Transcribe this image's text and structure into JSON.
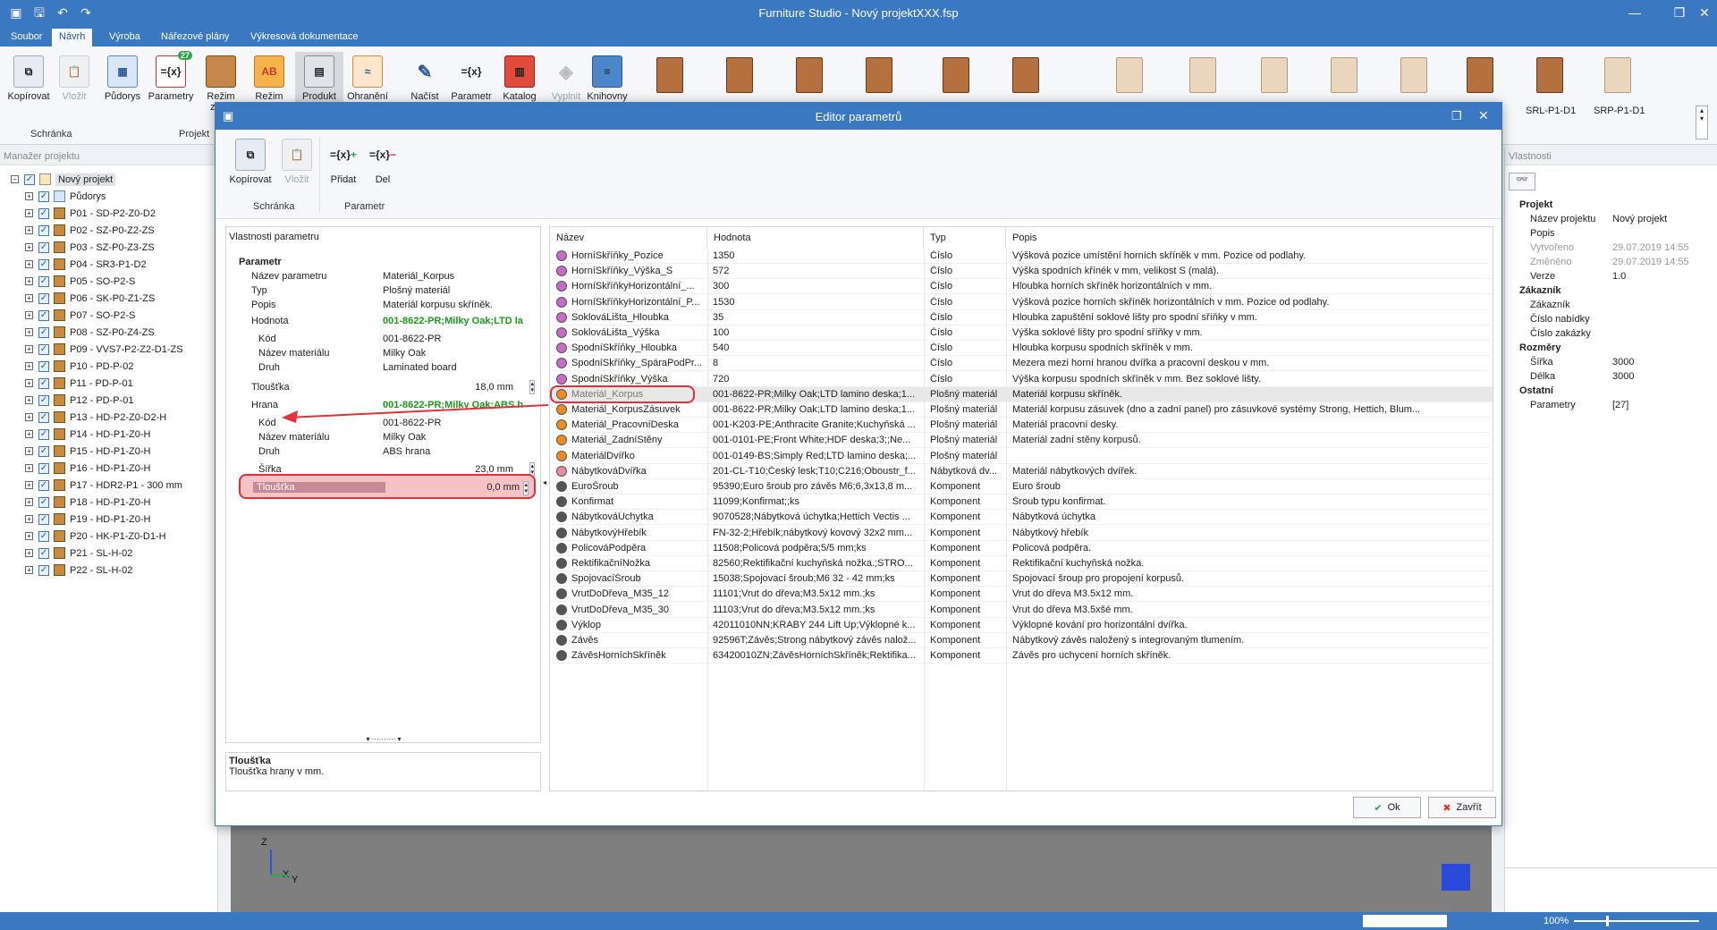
{
  "app": {
    "title": "Furniture Studio - Nový projektXXX.fsp"
  },
  "menu": [
    "Soubor",
    "Návrh",
    "Výroba",
    "Nářezové plány",
    "Výkresová dokumentace"
  ],
  "ribbon": {
    "buttons": [
      {
        "label": "Kopírovat",
        "icon": "copy-icon"
      },
      {
        "label": "Vložit",
        "icon": "paste-icon"
      },
      {
        "label": "Půdorys",
        "icon": "floorplan-icon"
      },
      {
        "label": "Parametry",
        "icon": "parameters-icon",
        "badge": "27"
      },
      {
        "label": "Režim zobr.",
        "icon": "display-mode-icon"
      },
      {
        "label": "Režim",
        "icon": "mode-icon"
      },
      {
        "label": "Produkt",
        "icon": "product-icon"
      },
      {
        "label": "Ohranění",
        "icon": "edging-icon"
      },
      {
        "label": "Načíst",
        "icon": "load-icon"
      },
      {
        "label": "Parametr",
        "icon": "parameter-icon"
      },
      {
        "label": "Katalog",
        "icon": "catalog-icon"
      },
      {
        "label": "Vyplnit",
        "icon": "fill-icon"
      },
      {
        "label": "Knihovny",
        "icon": "library-icon"
      }
    ],
    "groups": [
      "Schránka",
      "Projekt"
    ],
    "catalog_items": [
      "SRL-P1-D1",
      "SRP-P1-D1"
    ]
  },
  "project_manager": {
    "title": "Manažer projektu",
    "root": "Nový projekt",
    "items": [
      "Půdorys",
      "P01 - SD-P2-Z0-D2",
      "P02 - SZ-P0-Z2-ZS",
      "P03 - SZ-P0-Z3-ZS",
      "P04 - SR3-P1-D2",
      "P05 - SO-P2-S",
      "P06 - SK-P0-Z1-ZS",
      "P07 - SO-P2-S",
      "P08 - SZ-P0-Z4-ZS",
      "P09 - VVS7-P2-Z2-D1-ZS",
      "P10 - PD-P-02",
      "P11 - PD-P-01",
      "P12 - PD-P-01",
      "P13 - HD-P2-Z0-D2-H",
      "P14 - HD-P1-Z0-H",
      "P15 - HD-P1-Z0-H",
      "P16 - HD-P1-Z0-H",
      "P17 - HDR2-P1 - 300 mm",
      "P18 - HD-P1-Z0-H",
      "P19 - HD-P1-Z0-H",
      "P20 - HK-P1-Z0-D1-H",
      "P21 - SL-H-02",
      "P22 - SL-H-02"
    ]
  },
  "properties": {
    "title": "Vlastnosti",
    "rows": [
      {
        "k": "Projekt",
        "cat": true
      },
      {
        "k": "Název projektu",
        "v": "Nový projekt"
      },
      {
        "k": "Popis",
        "v": ""
      },
      {
        "k": "Vytvořeno",
        "v": "29.07.2019 14:55",
        "dim": true
      },
      {
        "k": "Změněno",
        "v": "29.07.2019 14:55",
        "dim": true
      },
      {
        "k": "Verze",
        "v": "1.0"
      },
      {
        "k": "Zákazník",
        "cat": true
      },
      {
        "k": "Zákazník",
        "v": ""
      },
      {
        "k": "Číslo nabídky",
        "v": ""
      },
      {
        "k": "Číslo zakázky",
        "v": ""
      },
      {
        "k": "Rozměry",
        "cat": true
      },
      {
        "k": "Šířka",
        "v": "3000"
      },
      {
        "k": "Délka",
        "v": "3000"
      },
      {
        "k": "Ostatní",
        "cat": true
      },
      {
        "k": "Parametry",
        "v": "[27]"
      }
    ]
  },
  "dialog": {
    "title": "Editor parametrů",
    "ribbon": [
      {
        "label": "Kopírovat",
        "icon": "copy-icon"
      },
      {
        "label": "Vložit",
        "icon": "paste-icon"
      },
      {
        "label": "Přidat",
        "icon": "add-parameter-icon"
      },
      {
        "label": "Del",
        "icon": "delete-parameter-icon"
      }
    ],
    "groups": [
      "Schránka",
      "Parametr"
    ],
    "param_props": {
      "title": "Vlastnosti parametru",
      "rows": [
        {
          "k": "Parametr",
          "cat": true
        },
        {
          "k": "Název parametru",
          "v": "Materiál_Korpus"
        },
        {
          "k": "Typ",
          "v": "Plošný materiál"
        },
        {
          "k": "Popis",
          "v": "Materiál korpusu skříněk."
        },
        {
          "k": "Hodnota",
          "v": "001-8622-PR;Milky Oak;LTD la",
          "green": true
        },
        {
          "k": "Kód",
          "v": "001-8622-PR",
          "sub": true
        },
        {
          "k": "Název materiálu",
          "v": "Milky Oak",
          "sub": true
        },
        {
          "k": "Druh",
          "v": "Laminated board",
          "sub": true
        },
        {
          "k": "Tloušťka",
          "num": "18,0 mm"
        },
        {
          "k": "Hrana",
          "v": "001-8622-PR;Milky Oak;ABS h",
          "green": true
        },
        {
          "k": "Kód",
          "v": "001-8622-PR",
          "sub": true
        },
        {
          "k": "Název materiálu",
          "v": "Milky Oak",
          "sub": true
        },
        {
          "k": "Druh",
          "v": "ABS hrana",
          "sub": true
        },
        {
          "k": "Šířka",
          "num": "23,0 mm",
          "sub": true
        },
        {
          "k": "Tloušťka",
          "num": "0,0 mm",
          "sub": true,
          "selected": true
        }
      ],
      "desc_title": "Tloušťka",
      "desc_text": "Tloušťka hrany v mm."
    },
    "grid": {
      "headers": [
        "Název",
        "Hodnota",
        "Typ",
        "Popis"
      ],
      "rows": [
        {
          "n": "HorníSkříňky_Pozice",
          "h": "1350",
          "t": "Číslo",
          "p": "Výšková pozice umístění horních skříněk v mm. Pozice od podlahy.",
          "c": "#c86ac8"
        },
        {
          "n": "HorníSkříňky_Výška_S",
          "h": "572",
          "t": "Číslo",
          "p": "Výška spodních křínék v mm, velikost S (malá).",
          "c": "#c86ac8"
        },
        {
          "n": "HorníSkříňkyHorizontální_...",
          "h": "300",
          "t": "Číslo",
          "p": "Hloubka horních skříněk horizontálních v mm.",
          "c": "#c86ac8"
        },
        {
          "n": "HorníSkříňkyHorizontální_P...",
          "h": "1530",
          "t": "Číslo",
          "p": "Výšková pozice horních skříněk horizontálních v mm. Pozice od podlahy.",
          "c": "#c86ac8"
        },
        {
          "n": "SoklováLišta_Hloubka",
          "h": "35",
          "t": "Číslo",
          "p": "Hloubka zapuštění soklové lišty pro spodní sříňky v mm.",
          "c": "#c86ac8"
        },
        {
          "n": "SoklováLišta_Výška",
          "h": "100",
          "t": "Číslo",
          "p": "Výška soklové lišty pro spodní sříňky v mm.",
          "c": "#c86ac8"
        },
        {
          "n": "SpodníSkříňky_Hloubka",
          "h": "540",
          "t": "Číslo",
          "p": "Hloubka korpusu spodních skříněk v mm.",
          "c": "#c86ac8"
        },
        {
          "n": "SpodníSkříňky_SpáraPodPr...",
          "h": "8",
          "t": "Číslo",
          "p": "Mezera mezi horní hranou dvířka a pracovní deskou v mm.",
          "c": "#c86ac8"
        },
        {
          "n": "SpodníSkříňky_Výška",
          "h": "720",
          "t": "Číslo",
          "p": "Výška korpusu spodních skříněk v mm. Bez soklové lišty.",
          "c": "#c86ac8"
        },
        {
          "n": "Materiál_Korpus",
          "h": "001-8622-PR;Milky Oak;LTD lamino deska;1...",
          "t": "Plošný materiál",
          "p": "Materiál korpusu skříněk.",
          "c": "#f08c1e",
          "sel": true
        },
        {
          "n": "Materiál_KorpusZásuvek",
          "h": "001-8622-PR;Milky Oak;LTD lamino deska;1...",
          "t": "Plošný materiál",
          "p": "Materiál korpusu zásuvek (dno a zadní panel) pro zásuvkové systémy Strong, Hettich, Blum...",
          "c": "#f08c1e"
        },
        {
          "n": "Materiál_PracovníDeska",
          "h": "001-K203-PE;Anthracite Granite;Kuchyňská ...",
          "t": "Plošný materiál",
          "p": "Materiál pracovní desky.",
          "c": "#f08c1e"
        },
        {
          "n": "Materiál_ZadníStěny",
          "h": "001-0101-PE;Front White;HDF deska;3;;Ne...",
          "t": "Plošný materiál",
          "p": "Materiál zadní stěny korpusů.",
          "c": "#f08c1e"
        },
        {
          "n": "MateriálDvířko",
          "h": "001-0149-BS;Simply Red;LTD lamino deska;...",
          "t": "Plošný materiál",
          "p": "",
          "c": "#f08c1e"
        },
        {
          "n": "NábytkováDvířka",
          "h": "201-CL-T10;Český lesk;T10;C216;Oboustr_f...",
          "t": "Nábytková dv...",
          "p": "Materiál nábytkových dvířek.",
          "c": "#ee8aa0"
        },
        {
          "n": "EuroŠroub",
          "h": "95390;Euro šroub pro závěs M6;6,3x13,8 m...",
          "t": "Komponent",
          "p": "Euro šroub",
          "c": "#555555"
        },
        {
          "n": "Konfirmat",
          "h": "11099;Konfirmat;;ks",
          "t": "Komponent",
          "p": "Šroub typu konfirmat.",
          "c": "#555555"
        },
        {
          "n": "NábytkováÚchytka",
          "h": "9070528;Nábytková úchytka;Hettich Vectis ...",
          "t": "Komponent",
          "p": "Nábytková úchytka",
          "c": "#555555"
        },
        {
          "n": "NábytkovýHřebík",
          "h": "FN-32-2;Hřebík;nábytkový kovový 32x2 mm...",
          "t": "Komponent",
          "p": "Nábytkový hřebík",
          "c": "#555555"
        },
        {
          "n": "PolicováPodpěra",
          "h": "11508;Policová podpěra;5/5 mm;ks",
          "t": "Komponent",
          "p": "Policová podpěra.",
          "c": "#555555"
        },
        {
          "n": "RektifikačníNožka",
          "h": "82560;Rektifikační kuchyňská nožka.;STRO...",
          "t": "Komponent",
          "p": "Rektifikační kuchyňská nožka.",
          "c": "#555555"
        },
        {
          "n": "SpojovacíŠroub",
          "h": "15038;Spojovací šroub;M6 32 - 42 mm;ks",
          "t": "Komponent",
          "p": "Spojovací šroup pro propojení korpusů.",
          "c": "#555555"
        },
        {
          "n": "VrutDoDřeva_M35_12",
          "h": "11101;Vrut do dřeva;M3.5x12 mm.;ks",
          "t": "Komponent",
          "p": "Vrut do dřeva M3.5x12 mm.",
          "c": "#555555"
        },
        {
          "n": "VrutDoDřeva_M35_30",
          "h": "11103;Vrut do dřeva;M3.5x12 mm.;ks",
          "t": "Komponent",
          "p": "Vrut do dřeva M3.5xšé mm.",
          "c": "#555555"
        },
        {
          "n": "Výklop",
          "h": "42011010NN;KRABY 244 Lift Up;Výklopné k...",
          "t": "Komponent",
          "p": "Výklopné kování pro horizontální dvířka.",
          "c": "#555555"
        },
        {
          "n": "Závěs",
          "h": "92596T;Závěs;Strong nábytkový závěs nalož...",
          "t": "Komponent",
          "p": "Nábytkový závěs naložený s integrovaným tlumením.",
          "c": "#555555"
        },
        {
          "n": "ZávěsHorníchSkříněk",
          "h": "63420010ZN;ZávěsHorníchSkříněk;Rektifika...",
          "t": "Komponent",
          "p": "Závěs pro uchycení horních skříněk.",
          "c": "#555555"
        }
      ]
    },
    "ok_label": "Ok",
    "close_label": "Zavřít"
  },
  "viewport": {
    "axes": [
      "Z",
      "X",
      "Y"
    ]
  },
  "status": {
    "zoom": "100%"
  },
  "colors": {
    "accent": "#3b78c2",
    "highlight": "#e2313a",
    "value_green": "#1c9a1c"
  }
}
